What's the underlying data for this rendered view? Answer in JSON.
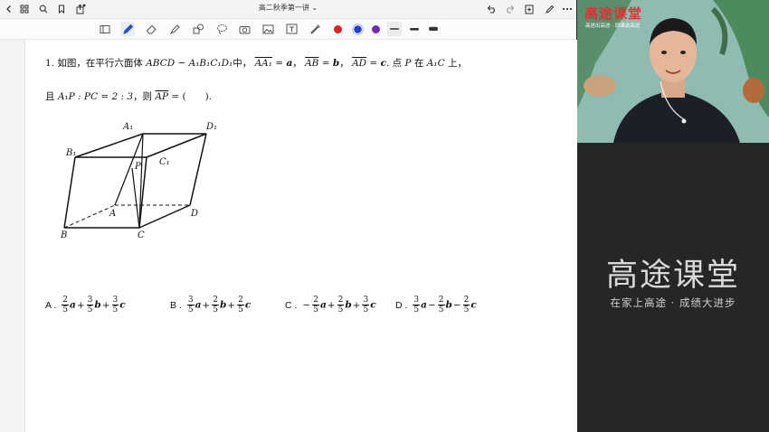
{
  "window": {
    "title": "高二秋季第一讲",
    "title_caret": "⌄"
  },
  "question": {
    "number": "1.",
    "line1_a": "如图，在平行六面体",
    "prism": "ABCD − A₁B₁C₁D₁",
    "line1_b": "中，",
    "v1": "AA₁",
    "v1_val": "a",
    "v2": "AB",
    "v2_val": "b",
    "v3": "AD",
    "v3_val": "c",
    "line1_c": ". 点",
    "pt": "P",
    "line1_d": "在",
    "seg": "A₁C",
    "line1_e": "上，",
    "line2_a": "且",
    "ratio": "A₁P : PC = 2 : 3",
    "line2_b": "，则",
    "target": "AP",
    "line2_c": "= (　　)."
  },
  "figure": {
    "labels": {
      "A1": "A₁",
      "D1": "D₁",
      "B1": "B₁",
      "C1": "C₁",
      "P": "P",
      "A": "A",
      "D": "D",
      "B": "B",
      "C": "C"
    }
  },
  "options": [
    {
      "label": "A .",
      "terms": [
        {
          "sign": "",
          "n": "2",
          "d": "5",
          "v": "a"
        },
        {
          "sign": "+",
          "n": "3",
          "d": "5",
          "v": "b"
        },
        {
          "sign": "+",
          "n": "3",
          "d": "5",
          "v": "c"
        }
      ]
    },
    {
      "label": "B .",
      "terms": [
        {
          "sign": "",
          "n": "3",
          "d": "5",
          "v": "a"
        },
        {
          "sign": "+",
          "n": "2",
          "d": "5",
          "v": "b"
        },
        {
          "sign": "+",
          "n": "2",
          "d": "5",
          "v": "c"
        }
      ]
    },
    {
      "label": "C .",
      "terms": [
        {
          "sign": "−",
          "n": "2",
          "d": "5",
          "v": "a"
        },
        {
          "sign": "+",
          "n": "2",
          "d": "5",
          "v": "b"
        },
        {
          "sign": "+",
          "n": "3",
          "d": "5",
          "v": "c"
        }
      ]
    },
    {
      "label": "D .",
      "terms": [
        {
          "sign": "",
          "n": "3",
          "d": "5",
          "v": "a"
        },
        {
          "sign": "−",
          "n": "2",
          "d": "5",
          "v": "b"
        },
        {
          "sign": "−",
          "n": "2",
          "d": "5",
          "v": "c"
        }
      ]
    }
  ],
  "video": {
    "logo": "高途课堂",
    "sublogo": "高途出高途 · 同课选高途"
  },
  "brand": {
    "logo": "高途课堂",
    "slogan": "在家上高途 · 成绩大进步"
  },
  "colors": {
    "pen_red": "#e02020",
    "pen_blue": "#1e3fd0",
    "pen_purple": "#7a2ab0",
    "brand_bg": "#262626",
    "brand_text": "#d9d9d9"
  }
}
